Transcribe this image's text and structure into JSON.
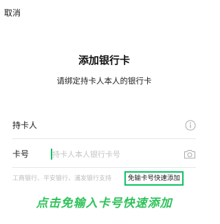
{
  "header": {
    "cancel_label": "取消"
  },
  "main": {
    "title": "添加银行卡",
    "subtitle": "请绑定持卡人本人的银行卡"
  },
  "form": {
    "holder_label": "持卡人",
    "card_label": "卡号",
    "card_placeholder": "持卡人本人银行卡号"
  },
  "supported_banks": "工商银行、平安银行、浦发银行支持",
  "quick_add_label": "免输卡号快速添加",
  "annotation": "点击免输入卡号快速添加",
  "icons": {
    "info": "info-icon",
    "camera": "camera-icon"
  },
  "colors": {
    "accent": "#07c160",
    "annotation": "#2fc25b"
  }
}
